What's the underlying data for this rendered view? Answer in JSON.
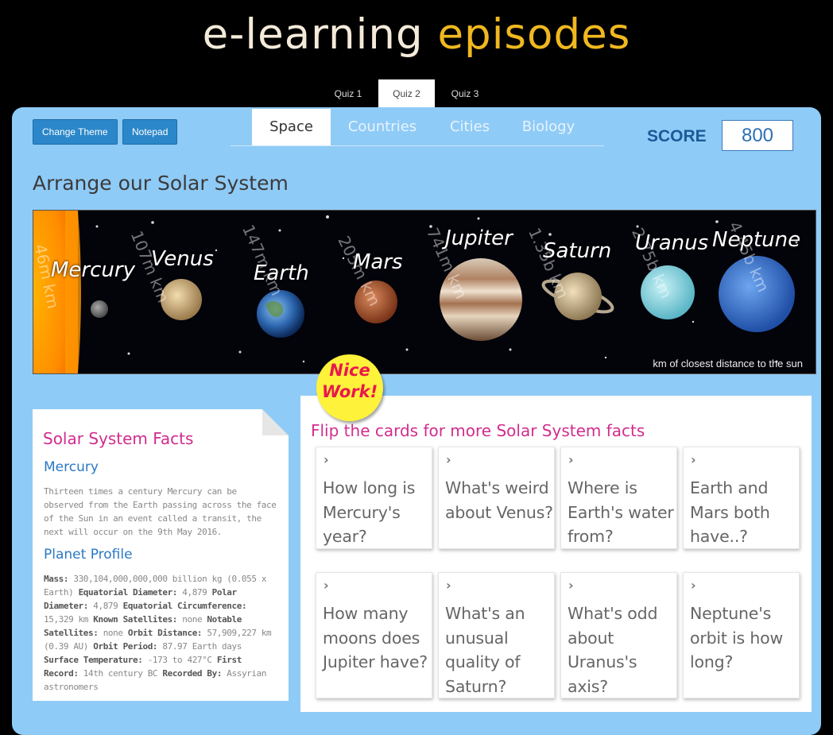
{
  "header": {
    "logo_part1": "e-learning",
    "logo_part2": "episodes"
  },
  "quiz_tabs": [
    {
      "label": "Quiz 1"
    },
    {
      "label": "Quiz 2"
    },
    {
      "label": "Quiz 3"
    }
  ],
  "quiz_tab_active": "Quiz 2",
  "toolbar": {
    "change_theme": "Change Theme",
    "notepad": "Notepad"
  },
  "category_tabs": [
    {
      "label": "Space"
    },
    {
      "label": "Countries"
    },
    {
      "label": "Cities"
    },
    {
      "label": "Biology"
    }
  ],
  "category_tab_active": "Space",
  "score": {
    "label": "SCORE",
    "value": "800"
  },
  "page_title": "Arrange our Solar System",
  "solar_system": {
    "planets": [
      {
        "name": "Mercury",
        "distance": "46m km"
      },
      {
        "name": "Venus",
        "distance": "107m km"
      },
      {
        "name": "Earth",
        "distance": "147m km"
      },
      {
        "name": "Mars",
        "distance": "205m km"
      },
      {
        "name": "Jupiter",
        "distance": "741m km"
      },
      {
        "name": "Saturn",
        "distance": "1.35b km"
      },
      {
        "name": "Uranus",
        "distance": "2.75b km"
      },
      {
        "name": "Neptune",
        "distance": "4.45b km"
      }
    ],
    "caption": "km of closest distance to the sun"
  },
  "badge": {
    "line1": "Nice",
    "line2": "Work!"
  },
  "facts": {
    "title": "Solar System Facts",
    "subtitle": "Mercury",
    "text": "Thirteen times a century Mercury can be observed from the Earth passing across the face of the Sun in an event called a transit, the next will occur on the 9th May 2016.",
    "profile_title": "Planet Profile",
    "profile": {
      "mass_label": "Mass:",
      "mass": "330,104,000,000,000 billion kg (0.055 x Earth)",
      "eq_diam_label": "Equatorial Diameter:",
      "eq_diam": "4,879",
      "polar_diam_label": "Polar Diameter:",
      "polar_diam": "4,879",
      "eq_circ_label": "Equatorial Circumference:",
      "eq_circ": "15,329 km",
      "known_sat_label": "Known Satellites:",
      "known_sat": "none",
      "notable_sat_label": "Notable Satellites:",
      "notable_sat": "none",
      "orbit_dist_label": "Orbit Distance:",
      "orbit_dist": "57,909,227 km (0.39 AU)",
      "orbit_period_label": "Orbit Period:",
      "orbit_period": "87.97 Earth days",
      "surface_temp_label": "Surface Temperature:",
      "surface_temp": "-173 to 427°C",
      "first_record_label": "First Record:",
      "first_record": "14th century BC",
      "recorded_by_label": "Recorded By:",
      "recorded_by": "Assyrian astronomers"
    }
  },
  "cards": {
    "title": "Flip the cards for more Solar System facts",
    "items": [
      {
        "question": "How long is Mercury's year?"
      },
      {
        "question": "What's weird about Venus?"
      },
      {
        "question": "Where is Earth's water from?"
      },
      {
        "question": "Earth and Mars both have..?"
      },
      {
        "question": "How many moons does Jupiter have?"
      },
      {
        "question": "What's an unusual quality of Saturn?"
      },
      {
        "question": "What's odd about Uranus's axis?"
      },
      {
        "question": "Neptune's orbit is how long?"
      }
    ]
  },
  "colors": {
    "panel_bg": "#8fcbf7",
    "accent_magenta": "#d12d8e",
    "accent_blue": "#2a78c4",
    "button_blue": "#2b87c9"
  }
}
